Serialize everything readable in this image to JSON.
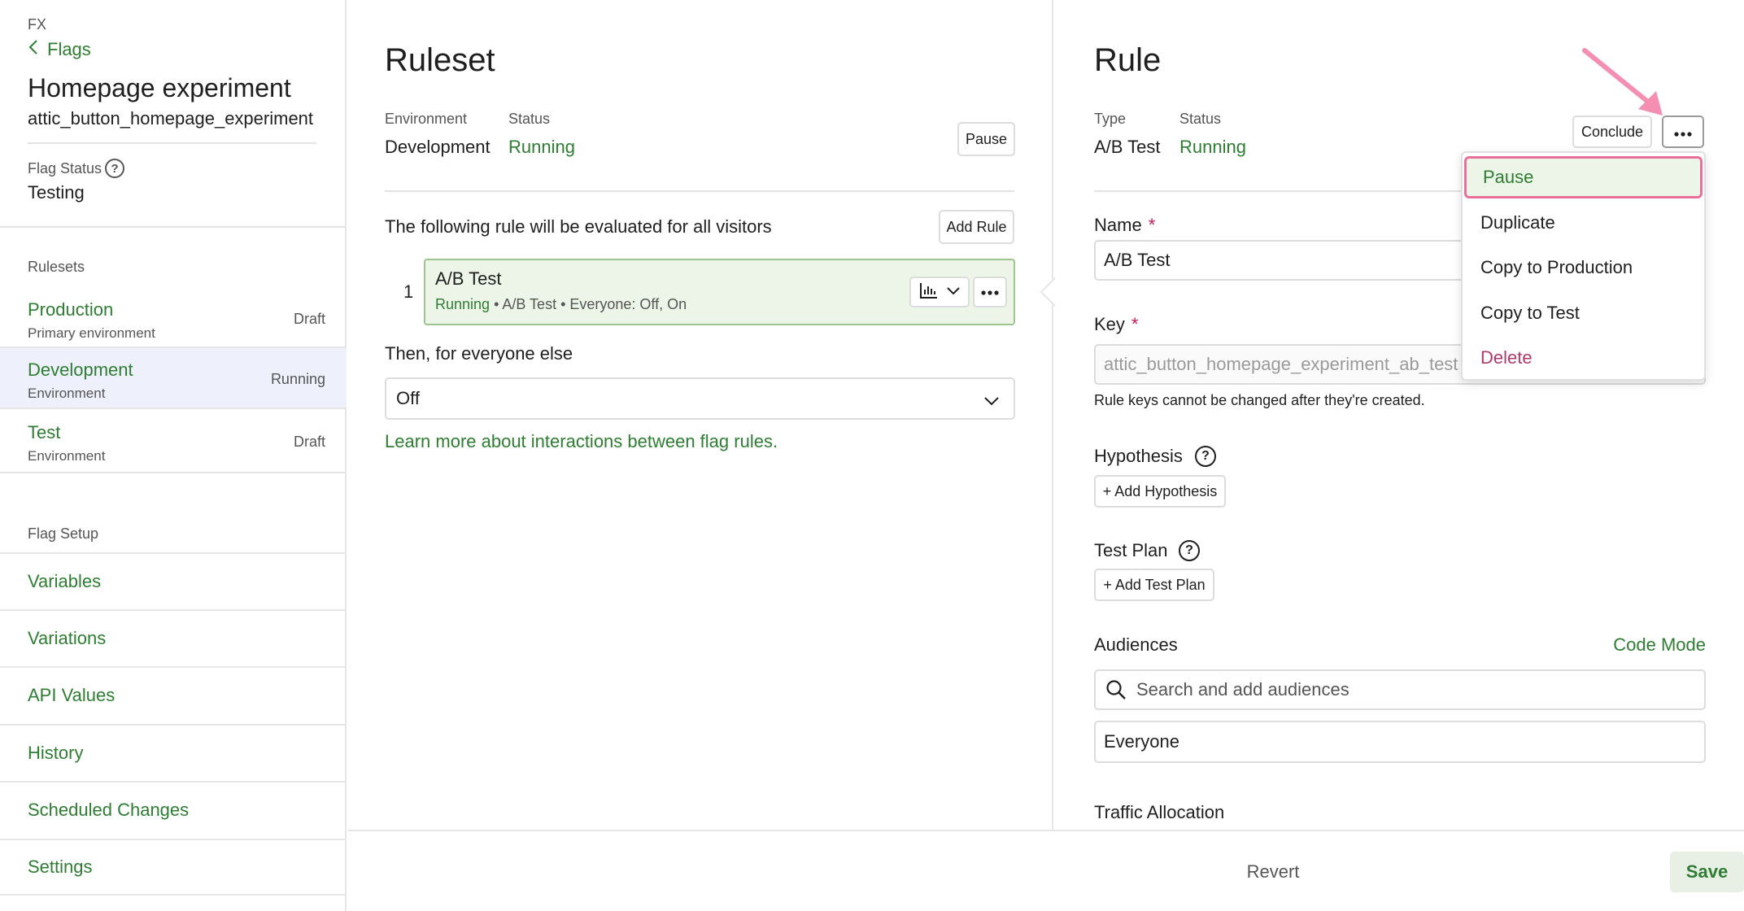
{
  "sidebar": {
    "app_label": "FX",
    "back_link": "Flags",
    "flag_title": "Homepage experiment",
    "flag_key": "attic_button_homepage_experiment",
    "flag_status_label": "Flag Status",
    "flag_status_value": "Testing",
    "rulesets_label": "Rulesets",
    "rulesets": [
      {
        "name": "Production",
        "sub": "Primary environment",
        "state": "Draft"
      },
      {
        "name": "Development",
        "sub": "Environment",
        "state": "Running"
      },
      {
        "name": "Test",
        "sub": "Environment",
        "state": "Draft"
      }
    ],
    "setup_label": "Flag Setup",
    "nav": [
      "Variables",
      "Variations",
      "API Values",
      "History",
      "Scheduled Changes",
      "Settings"
    ]
  },
  "ruleset": {
    "title": "Ruleset",
    "env_label": "Environment",
    "env_value": "Development",
    "status_label": "Status",
    "status_value": "Running",
    "pause_button": "Pause",
    "rules_text": "The following rule will be evaluated for all visitors",
    "add_rule_button": "Add Rule",
    "rule": {
      "number": "1",
      "title": "A/B Test",
      "status": "Running",
      "details": " • A/B Test • Everyone: Off, On"
    },
    "then_text": "Then, for everyone else",
    "else_value": "Off",
    "learn_link": "Learn more about interactions between flag rules."
  },
  "rule_panel": {
    "title": "Rule",
    "type_label": "Type",
    "type_value": "A/B Test",
    "status_label": "Status",
    "status_value": "Running",
    "conclude_button": "Conclude",
    "name_label": "Name",
    "name_value": "A/B Test",
    "key_label": "Key",
    "key_value": "attic_button_homepage_experiment_ab_test",
    "key_help": "Rule keys cannot be changed after they're created.",
    "hypothesis_label": "Hypothesis",
    "add_hypothesis": "+ Add Hypothesis",
    "test_plan_label": "Test Plan",
    "add_test_plan": "+ Add Test Plan",
    "audiences_label": "Audiences",
    "code_mode": "Code Mode",
    "search_placeholder": "Search and add audiences",
    "audience_value": "Everyone",
    "traffic_label": "Traffic Allocation",
    "required_mark": "*"
  },
  "menu": {
    "items": [
      "Pause",
      "Duplicate",
      "Copy to Production",
      "Copy to Test",
      "Delete"
    ]
  },
  "footer": {
    "revert": "Revert",
    "save": "Save"
  },
  "colors": {
    "accent_green": "#2e7d32",
    "highlight_pink": "#e8709a",
    "active_bg": "#eef1fb"
  }
}
